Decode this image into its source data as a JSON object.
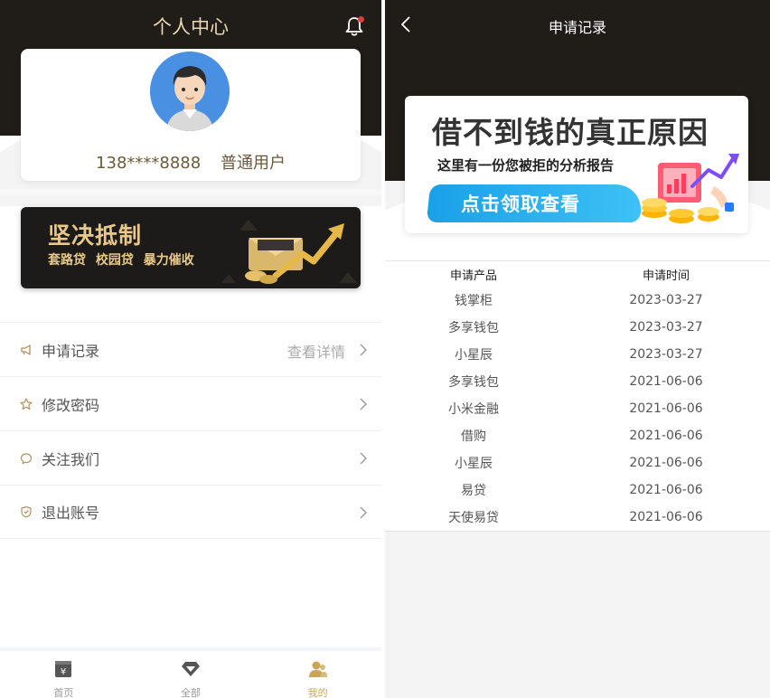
{
  "left": {
    "header_title": "个人中心",
    "profile": {
      "phone": "138****8888",
      "role": "普通用户"
    },
    "banner": {
      "title": "坚决抵制",
      "tags": [
        "套路贷",
        "校园贷",
        "暴力催收"
      ]
    },
    "menu": [
      {
        "label": "申请记录",
        "extra": "查看详情",
        "icon": "megaphone-icon"
      },
      {
        "label": "修改密码",
        "extra": "",
        "icon": "star-icon"
      },
      {
        "label": "关注我们",
        "extra": "",
        "icon": "chat-icon"
      },
      {
        "label": "退出账号",
        "extra": "",
        "icon": "shield-icon"
      }
    ],
    "tabs": [
      {
        "label": "首页",
        "icon": "home-icon",
        "active": false
      },
      {
        "label": "全部",
        "icon": "diamond-icon",
        "active": false
      },
      {
        "label": "我的",
        "icon": "user-icon",
        "active": true
      }
    ]
  },
  "right": {
    "header_title": "申请记录",
    "promo": {
      "title": "借不到钱的真正原因",
      "subtitle": "这里有一份您被拒的分析报告",
      "button": "点击领取查看"
    },
    "records": {
      "columns": [
        "申请产品",
        "申请时间"
      ],
      "rows": [
        [
          "钱掌柜",
          "2023-03-27"
        ],
        [
          "多享钱包",
          "2023-03-27"
        ],
        [
          "小星辰",
          "2023-03-27"
        ],
        [
          "多享钱包",
          "2021-06-06"
        ],
        [
          "小米金融",
          "2021-06-06"
        ],
        [
          "借购",
          "2021-06-06"
        ],
        [
          "小星辰",
          "2021-06-06"
        ],
        [
          "易贷",
          "2021-06-06"
        ],
        [
          "天使易贷",
          "2021-06-06"
        ]
      ]
    }
  },
  "colors": {
    "header_dark": "#201c18",
    "gold": "#c9a55a",
    "banner_gold": "#e8c98a",
    "promo_blue": "#1aa0e8"
  }
}
